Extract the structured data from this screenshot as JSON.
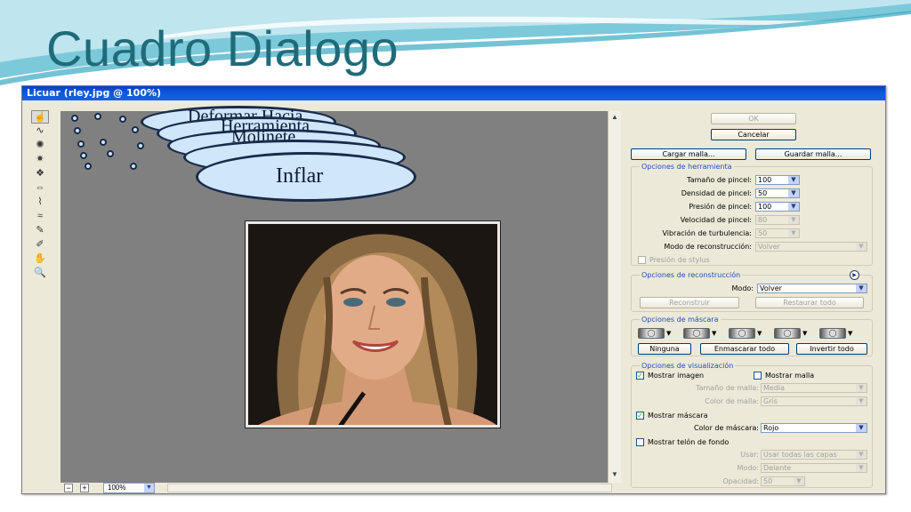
{
  "slide": {
    "title": "Cuadro Dialogo"
  },
  "window": {
    "title": "Licuar (rley.jpg @ 100%)"
  },
  "tools": [
    {
      "icon": "warp-tool-icon",
      "glyph": "☝"
    },
    {
      "icon": "reconstruct-tool-icon",
      "glyph": "∿"
    },
    {
      "icon": "twirl-tool-icon",
      "glyph": "✺"
    },
    {
      "icon": "pucker-tool-icon",
      "glyph": "✷"
    },
    {
      "icon": "bloat-tool-icon",
      "glyph": "❖"
    },
    {
      "icon": "push-left-tool-icon",
      "glyph": "⇔"
    },
    {
      "icon": "mirror-tool-icon",
      "glyph": "⌇"
    },
    {
      "icon": "turbulence-tool-icon",
      "glyph": "≈"
    },
    {
      "icon": "freeze-mask-tool-icon",
      "glyph": "✎"
    },
    {
      "icon": "thaw-mask-tool-icon",
      "glyph": "✐"
    },
    {
      "icon": "hand-tool-icon",
      "glyph": "✋"
    },
    {
      "icon": "zoom-tool-icon",
      "glyph": "🔍"
    }
  ],
  "callouts": {
    "c1": "Deformar Hacia",
    "c2": "Herramienta",
    "c3": "Molinete",
    "c4": "Inflar"
  },
  "bottombar": {
    "zoom_out": "−",
    "zoom_in": "+",
    "zoom": "100%"
  },
  "buttons": {
    "ok": "OK",
    "cancel": "Cancelar",
    "load_mesh": "Cargar malla...",
    "save_mesh": "Guardar malla..."
  },
  "tool_options": {
    "title": "Opciones de herramienta",
    "brush_size_label": "Tamaño de pincel:",
    "brush_size": "100",
    "brush_density_label": "Densidad de pincel:",
    "brush_density": "50",
    "brush_pressure_label": "Presión de pincel:",
    "brush_pressure": "100",
    "brush_rate_label": "Velocidad de pincel:",
    "brush_rate": "80",
    "turbulent_jitter_label": "Vibración de turbulencia:",
    "turbulent_jitter": "50",
    "reconstruct_mode_label": "Modo de reconstrucción:",
    "reconstruct_mode": "Volver",
    "stylus_pressure": "Presión de stylus"
  },
  "reconstruct_options": {
    "title": "Opciones de reconstrucción",
    "mode_label": "Modo:",
    "mode": "Volver",
    "reconstruct": "Reconstruir",
    "restore_all": "Restaurar todo"
  },
  "mask_options": {
    "title": "Opciones de máscara",
    "none": "Ninguna",
    "mask_all": "Enmascarar todo",
    "invert_all": "Invertir todo"
  },
  "view_options": {
    "title": "Opciones de visualización",
    "show_image": "Mostrar imagen",
    "show_mesh": "Mostrar malla",
    "mesh_size_label": "Tamaño de malla:",
    "mesh_size": "Media",
    "mesh_color_label": "Color de malla:",
    "mesh_color": "Gris",
    "show_mask": "Mostrar máscara",
    "mask_color_label": "Color de máscara:",
    "mask_color": "Rojo",
    "show_backdrop": "Mostrar telón de fondo",
    "use_label": "Usar:",
    "use": "Usar todas las capas",
    "mode_label": "Modo:",
    "mode": "Delante",
    "opacity_label": "Opacidad:",
    "opacity": "50"
  },
  "colors": {
    "title": "#1f6b7a",
    "titlebar": "#0a58dc",
    "cloud_fill": "#cfe6fb",
    "cloud_border": "#1a2b4a",
    "group_title": "#1f4fb4"
  }
}
